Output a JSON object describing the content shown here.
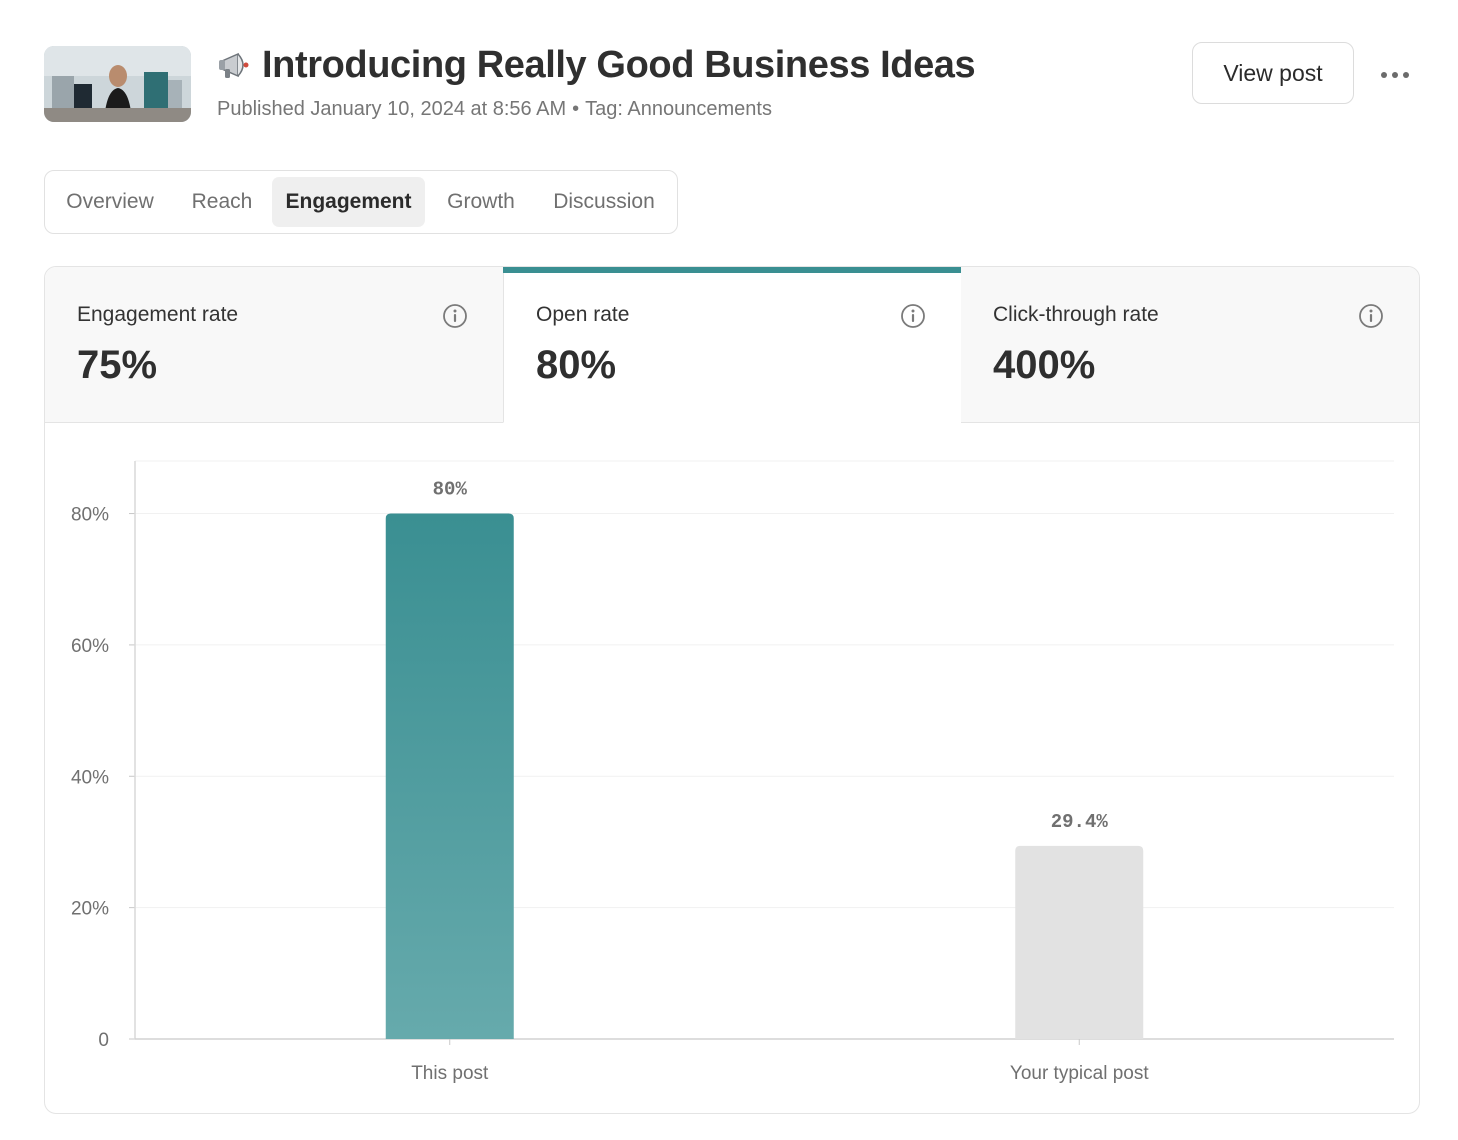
{
  "post": {
    "title": "Introducing Really Good Business Ideas",
    "title_icon": "megaphone-icon",
    "published": "Published January 10, 2024 at 8:56 AM",
    "separator": "•",
    "tag": "Tag: Announcements"
  },
  "actions": {
    "view_post_label": "View post",
    "more_icon": "more-horizontal-icon"
  },
  "tabs": [
    {
      "label": "Overview",
      "active": false
    },
    {
      "label": "Reach",
      "active": false
    },
    {
      "label": "Engagement",
      "active": true
    },
    {
      "label": "Growth",
      "active": false
    },
    {
      "label": "Discussion",
      "active": false
    }
  ],
  "metrics": [
    {
      "label": "Engagement rate",
      "value": "75%",
      "active": false,
      "icon": "info-icon"
    },
    {
      "label": "Open rate",
      "value": "80%",
      "active": true,
      "icon": "info-icon"
    },
    {
      "label": "Click-through rate",
      "value": "400%",
      "active": false,
      "icon": "info-icon"
    }
  ],
  "colors": {
    "accent": "#3a8f92",
    "bar_primary_top": "#3a8f92",
    "bar_primary_bottom": "#66aaac",
    "bar_secondary": "#e2e2e2"
  },
  "chart_data": {
    "type": "bar",
    "categories": [
      "This post",
      "Your typical post"
    ],
    "values": [
      80,
      29.4
    ],
    "value_labels": [
      "80%",
      "29.4%"
    ],
    "y_ticks": [
      "0",
      "20%",
      "40%",
      "60%",
      "80%"
    ],
    "y_tick_values": [
      0,
      20,
      40,
      60,
      80
    ],
    "ylim": [
      0,
      88
    ],
    "grid": true,
    "title": "",
    "xlabel": "",
    "ylabel": ""
  }
}
